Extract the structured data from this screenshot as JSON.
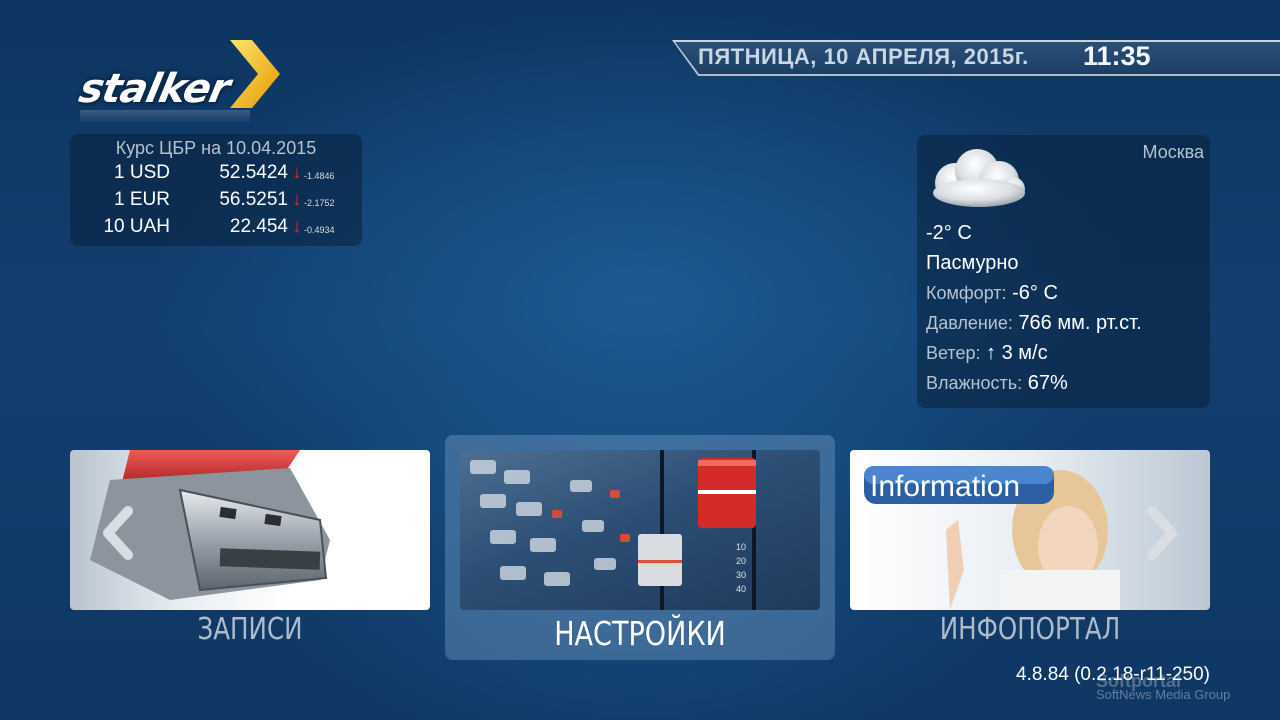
{
  "logo": {
    "text": "stalker"
  },
  "header": {
    "date": "ПЯТНИЦА, 10 АПРЕЛЯ, 2015г.",
    "time": "11:35"
  },
  "currency": {
    "title": "Курс ЦБР на 10.04.2015",
    "rows": [
      {
        "name": "1 USD",
        "value": "52.5424",
        "arrow": "↓",
        "delta": "-1.4846"
      },
      {
        "name": "1 EUR",
        "value": "56.5251",
        "arrow": "↓",
        "delta": "-2.1752"
      },
      {
        "name": "10 UAH",
        "value": "22.454",
        "arrow": "↓",
        "delta": "-0.4934"
      }
    ]
  },
  "weather": {
    "city": "Москва",
    "icon": "cloud-icon",
    "temperature": "-2° C",
    "condition": "Пасмурно",
    "comfort_label": "Комфорт:",
    "comfort_value": "-6° C",
    "pressure_label": "Давление:",
    "pressure_value": "766 мм. рт.ст.",
    "wind_label": "Ветер:",
    "wind_value": "↑ 3 м/с",
    "humidity_label": "Влажность:",
    "humidity_value": "67%"
  },
  "carousel": {
    "items": [
      {
        "label": "ЗАПИСИ",
        "icon": "usb-drive-image"
      },
      {
        "label": "НАСТРОЙКИ",
        "icon": "mixer-console-image",
        "active": true
      },
      {
        "label": "ИНФОПОРТАЛ",
        "icon": "info-woman-image",
        "badge": "Information"
      }
    ],
    "prev_icon": "chevron-left-icon",
    "next_icon": "chevron-right-icon"
  },
  "footer": {
    "version": "4.8.84 (0.2.18-r11-250)",
    "watermark_title": "Softportal",
    "watermark_sub": "SoftNews Media Group"
  },
  "colors": {
    "background": "#123f6f",
    "accent_yellow": "#f5b800",
    "down_arrow": "#e0242a"
  }
}
